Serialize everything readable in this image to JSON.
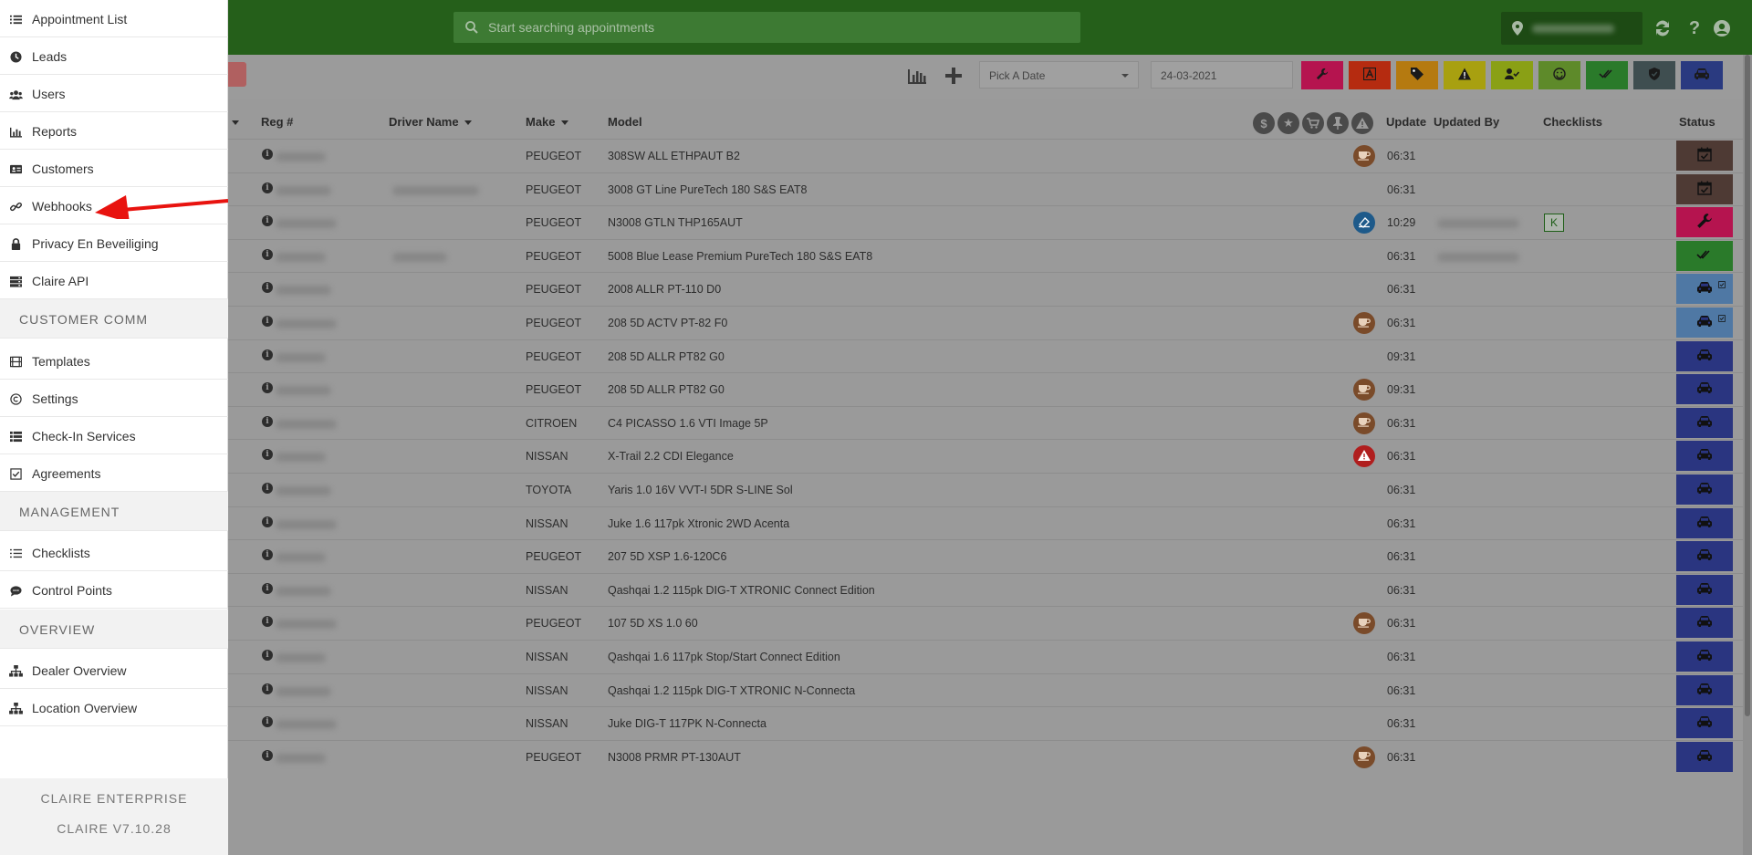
{
  "search": {
    "placeholder": "Start searching appointments"
  },
  "toolbar": {
    "date_placeholder": "Pick A Date",
    "date_value": "24-03-2021",
    "filters": [
      {
        "icon": "wrench-icon",
        "color": "#b5144f"
      },
      {
        "icon": "letter-a-icon",
        "color": "#b52b10"
      },
      {
        "icon": "tag-icon",
        "color": "#b57a10"
      },
      {
        "icon": "warning-icon",
        "color": "#a8a010"
      },
      {
        "icon": "user-check-icon",
        "color": "#8aa015"
      },
      {
        "icon": "smile-icon",
        "color": "#5e8a2a"
      },
      {
        "icon": "double-check-icon",
        "color": "#2a7a2a"
      },
      {
        "icon": "shield-icon",
        "color": "#3f4e50"
      },
      {
        "icon": "car-icon",
        "color": "#2a3a80"
      }
    ]
  },
  "table": {
    "headers": {
      "reg": "Reg #",
      "driver": "Driver Name",
      "make": "Make",
      "model": "Model",
      "update": "Update",
      "updated_by": "Updated By",
      "checklists": "Checklists",
      "status": "Status"
    },
    "rows": [
      {
        "make": "PEUGEOT",
        "model": "308SW ALL ETHPAUT B2",
        "badge": "coffee",
        "update": "06:31",
        "status": "checked"
      },
      {
        "make": "PEUGEOT",
        "model": "3008 GT Line PureTech 180 S&S EAT8",
        "badge": "",
        "update": "06:31",
        "status": "checked"
      },
      {
        "make": "PEUGEOT",
        "model": "N3008 GTLN THP165AUT",
        "badge": "pickup",
        "update": "10:29",
        "status": "wrench",
        "checklist": "K"
      },
      {
        "make": "PEUGEOT",
        "model": "5008 Blue Lease Premium PureTech 180 S&S EAT8",
        "badge": "",
        "update": "06:31",
        "status": "done"
      },
      {
        "make": "PEUGEOT",
        "model": "2008 ALLR PT-110 D0",
        "badge": "",
        "update": "06:31",
        "status": "car-checked"
      },
      {
        "make": "PEUGEOT",
        "model": "208 5D ACTV PT-82 F0",
        "badge": "coffee",
        "update": "06:31",
        "status": "car-checked"
      },
      {
        "make": "PEUGEOT",
        "model": "208 5D ALLR PT82 G0",
        "badge": "",
        "update": "09:31",
        "status": "car"
      },
      {
        "make": "PEUGEOT",
        "model": "208 5D ALLR PT82 G0",
        "badge": "coffee",
        "update": "09:31",
        "status": "car"
      },
      {
        "make": "CITROEN",
        "model": "C4 PICASSO 1.6 VTI Image 5P",
        "badge": "coffee",
        "update": "06:31",
        "status": "car"
      },
      {
        "make": "NISSAN",
        "model": "X-Trail 2.2 CDI Elegance",
        "badge": "alert",
        "update": "06:31",
        "status": "car"
      },
      {
        "make": "TOYOTA",
        "model": "Yaris 1.0 16V VVT-I 5DR S-LINE Sol",
        "badge": "",
        "update": "06:31",
        "status": "car"
      },
      {
        "make": "NISSAN",
        "model": "Juke 1.6 117pk Xtronic 2WD Acenta",
        "badge": "",
        "update": "06:31",
        "status": "car"
      },
      {
        "make": "PEUGEOT",
        "model": "207 5D XSP 1.6-120C6",
        "badge": "",
        "update": "06:31",
        "status": "car"
      },
      {
        "make": "NISSAN",
        "model": "Qashqai 1.2 115pk DIG-T XTRONIC Connect Edition",
        "badge": "",
        "update": "06:31",
        "status": "car"
      },
      {
        "make": "PEUGEOT",
        "model": "107 5D XS 1.0 60",
        "badge": "coffee",
        "update": "06:31",
        "status": "car"
      },
      {
        "make": "NISSAN",
        "model": "Qashqai 1.6 117pk Stop/Start Connect Edition",
        "badge": "",
        "update": "06:31",
        "status": "car"
      },
      {
        "make": "NISSAN",
        "model": "Qashqai 1.2 115pk DIG-T XTRONIC N-Connecta",
        "badge": "",
        "update": "06:31",
        "status": "car"
      },
      {
        "make": "NISSAN",
        "model": "Juke DIG-T 117PK N-Connecta",
        "badge": "",
        "update": "06:31",
        "status": "car"
      },
      {
        "make": "PEUGEOT",
        "model": "N3008 PRMR PT-130AUT",
        "badge": "coffee",
        "update": "06:31",
        "status": "car"
      }
    ]
  },
  "sidebar": {
    "items": [
      {
        "label": "Appointment List",
        "icon": "list-icon"
      },
      {
        "label": "Leads",
        "icon": "clock-icon"
      },
      {
        "label": "Users",
        "icon": "users-icon"
      },
      {
        "label": "Reports",
        "icon": "bar-chart-icon"
      },
      {
        "label": "Customers",
        "icon": "id-card-icon"
      },
      {
        "label": "Webhooks",
        "icon": "link-icon"
      },
      {
        "label": "Privacy En Beveiliging",
        "icon": "lock-icon"
      },
      {
        "label": "Claire API",
        "icon": "server-icon"
      }
    ],
    "section_customer_comm": "CUSTOMER COMM",
    "comm_items": [
      {
        "label": "Templates",
        "icon": "film-icon"
      },
      {
        "label": "Settings",
        "icon": "copyright-icon"
      },
      {
        "label": "Check-In Services",
        "icon": "table-list-icon"
      },
      {
        "label": "Agreements",
        "icon": "checkbox-icon"
      }
    ],
    "section_management": "MANAGEMENT",
    "mgmt_items": [
      {
        "label": "Checklists",
        "icon": "list-ol-icon"
      },
      {
        "label": "Control Points",
        "icon": "comment-icon"
      }
    ],
    "section_overview": "OVERVIEW",
    "overview_items": [
      {
        "label": "Dealer Overview",
        "icon": "sitemap-icon"
      },
      {
        "label": "Location Overview",
        "icon": "sitemap-icon"
      }
    ],
    "footer_line1": "CLAIRE ENTERPRISE",
    "footer_line2": "CLAIRE V7.10.28"
  },
  "colors": {
    "topbar": "#255f1a",
    "overlay": "#9b9b9b",
    "status_checked": "#4e3a34",
    "status_wrench": "#b5144f",
    "status_done": "#2a7a2a",
    "status_car_checked": "#4f78a4",
    "status_car": "#2a3580",
    "badge_coffee": "#7a4b2a",
    "badge_pickup": "#1e5a8a",
    "badge_alert": "#b01e1e",
    "arrow": "#e8130f"
  }
}
